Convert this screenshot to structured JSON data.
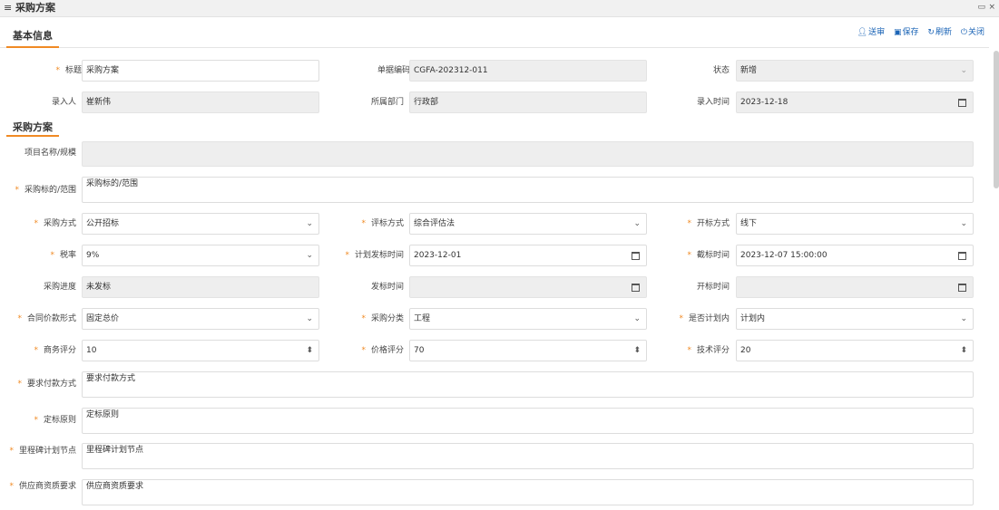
{
  "window": {
    "title": "采购方案",
    "menu_icon": "≡",
    "restore_icon": "▭",
    "close_icon": "×"
  },
  "tab": {
    "label": "基本信息"
  },
  "toolbar": {
    "submit_label": "送审",
    "save_label": "保存",
    "refresh_label": "刷新",
    "close_label": "关闭",
    "submit_icon": "user-icon",
    "save_icon": "floppy-icon",
    "refresh_icon": "refresh-icon",
    "close_icon": "power-icon"
  },
  "section": {
    "title": "采购方案"
  },
  "form": {
    "title_label": "标题",
    "title_value": "采购方案",
    "doc_no_label": "单据编码",
    "doc_no_value": "CGFA-202312-011",
    "status_label": "状态",
    "status_value": "新增",
    "entered_by_label": "录入人",
    "entered_by_value": "崔新伟",
    "dept_label": "所属部门",
    "dept_value": "行政部",
    "entry_time_label": "录入时间",
    "entry_time_value": "2023-12-18",
    "project_label": "项目名称/规模",
    "project_value": "",
    "target_label": "采购标的/范围",
    "target_value": "采购标的/范围",
    "method_label": "采购方式",
    "method_value": "公开招标",
    "eval_label": "评标方式",
    "eval_value": "综合评估法",
    "opening_label": "开标方式",
    "opening_value": "线下",
    "tax_label": "税率",
    "tax_value": "9%",
    "plan_date_label": "计划发标时间",
    "plan_date_value": "2023-12-01",
    "deadline_label": "截标时间",
    "deadline_value": "2023-12-07 15:00:00",
    "progress_label": "采购进度",
    "progress_value": "未发标",
    "release_label": "发标时间",
    "release_value": "",
    "open_time_label": "开标时间",
    "open_time_value": "",
    "contract_label": "合同价款形式",
    "contract_value": "固定总价",
    "category_label": "采购分类",
    "category_value": "工程",
    "in_plan_label": "是否计划内",
    "in_plan_value": "计划内",
    "biz_score_label": "商务评分",
    "biz_score_value": "10",
    "price_score_label": "价格评分",
    "price_score_value": "70",
    "tech_score_label": "技术评分",
    "tech_score_value": "20",
    "payment_label": "要求付款方式",
    "payment_value": "要求付款方式",
    "award_label": "定标原则",
    "award_value": "定标原则",
    "milestone_label": "里程碑计划节点",
    "milestone_value": "里程碑计划节点",
    "supplier_label": "供应商资质要求",
    "supplier_value": "供应商资质要求"
  },
  "symbols": {
    "required": "*",
    "dropdown": "⌄",
    "spinner": "⬍"
  }
}
